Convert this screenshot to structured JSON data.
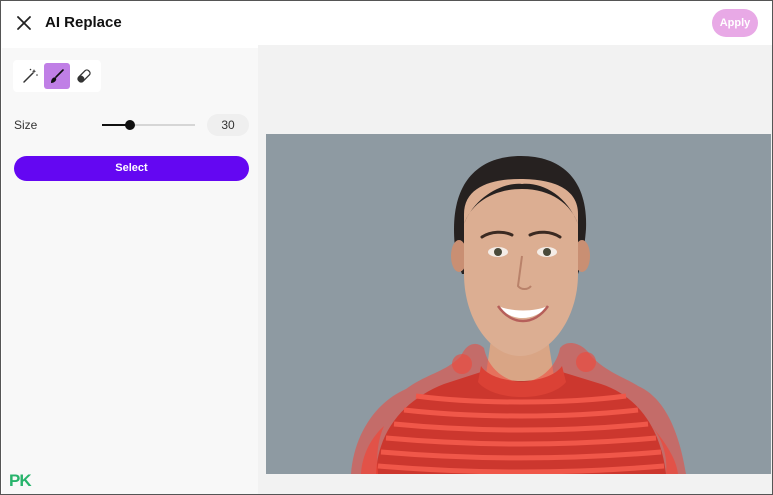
{
  "header": {
    "title": "AI Replace",
    "apply_label": "Apply",
    "close_icon": "close-icon"
  },
  "sidebar": {
    "tools": [
      {
        "name": "magic-wand-icon",
        "active": false
      },
      {
        "name": "brush-icon",
        "active": true
      },
      {
        "name": "eraser-icon",
        "active": false
      }
    ],
    "size": {
      "label": "Size",
      "value": "30",
      "slider_min": 0,
      "slider_max": 100,
      "slider_value": 30
    },
    "select_label": "Select"
  },
  "watermark": {
    "p": "P",
    "k": "K"
  },
  "colors": {
    "accent": "#6407f2",
    "apply_disabled": "#e8a9e6",
    "active_tool": "#c07fe6",
    "mask_overlay": "#f0473a"
  }
}
